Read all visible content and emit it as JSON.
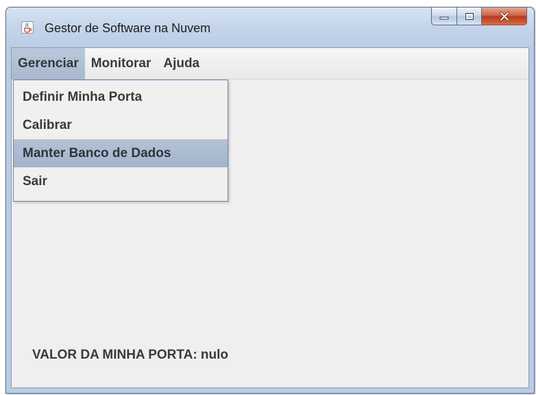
{
  "window": {
    "title": "Gestor de Software na Nuvem",
    "icon": "java-cup-icon"
  },
  "caption_buttons": {
    "minimize_icon": "minimize-icon",
    "maximize_icon": "maximize-icon",
    "close_icon": "close-icon"
  },
  "menubar": {
    "items": [
      {
        "label": "Gerenciar",
        "active": true
      },
      {
        "label": "Monitorar",
        "active": false
      },
      {
        "label": "Ajuda",
        "active": false
      }
    ]
  },
  "dropdown": {
    "items": [
      {
        "label": "Definir Minha Porta",
        "highlighted": false
      },
      {
        "label": "Calibrar",
        "highlighted": false
      },
      {
        "label": "Manter Banco de Dados",
        "highlighted": true
      },
      {
        "label": "Sair",
        "highlighted": false
      }
    ]
  },
  "status": {
    "label": "VALOR DA MINHA PORTA: nulo"
  },
  "colors": {
    "menu_highlight": "#a7b8cd",
    "client_background": "#efefef",
    "close_button": "#c8452a"
  }
}
